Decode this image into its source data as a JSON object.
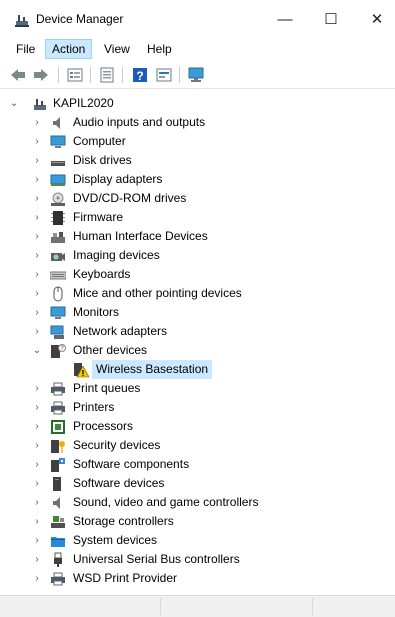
{
  "window": {
    "title": "Device Manager",
    "minimize": "—",
    "maximize": "☐",
    "close": "✕"
  },
  "menu": {
    "items": [
      "File",
      "Action",
      "View",
      "Help"
    ],
    "active": "Action"
  },
  "toolbar": {
    "buttons": [
      "back-icon",
      "forward-icon",
      "properties-icon",
      "update-driver-icon",
      "help-icon",
      "show-hidden-icon",
      "scan-hardware-icon"
    ]
  },
  "tree": {
    "root": "KAPIL2020",
    "categories": [
      "Audio inputs and outputs",
      "Computer",
      "Disk drives",
      "Display adapters",
      "DVD/CD-ROM drives",
      "Firmware",
      "Human Interface Devices",
      "Imaging devices",
      "Keyboards",
      "Mice and other pointing devices",
      "Monitors",
      "Network adapters",
      "Other devices",
      "Wireless Basestation",
      "Print queues",
      "Printers",
      "Processors",
      "Security devices",
      "Software components",
      "Software devices",
      "Sound, video and game controllers",
      "Storage controllers",
      "System devices",
      "Universal Serial Bus controllers",
      "WSD Print Provider"
    ]
  },
  "colors": {
    "selection": "#cce8ff",
    "accent": "#0078d7"
  }
}
